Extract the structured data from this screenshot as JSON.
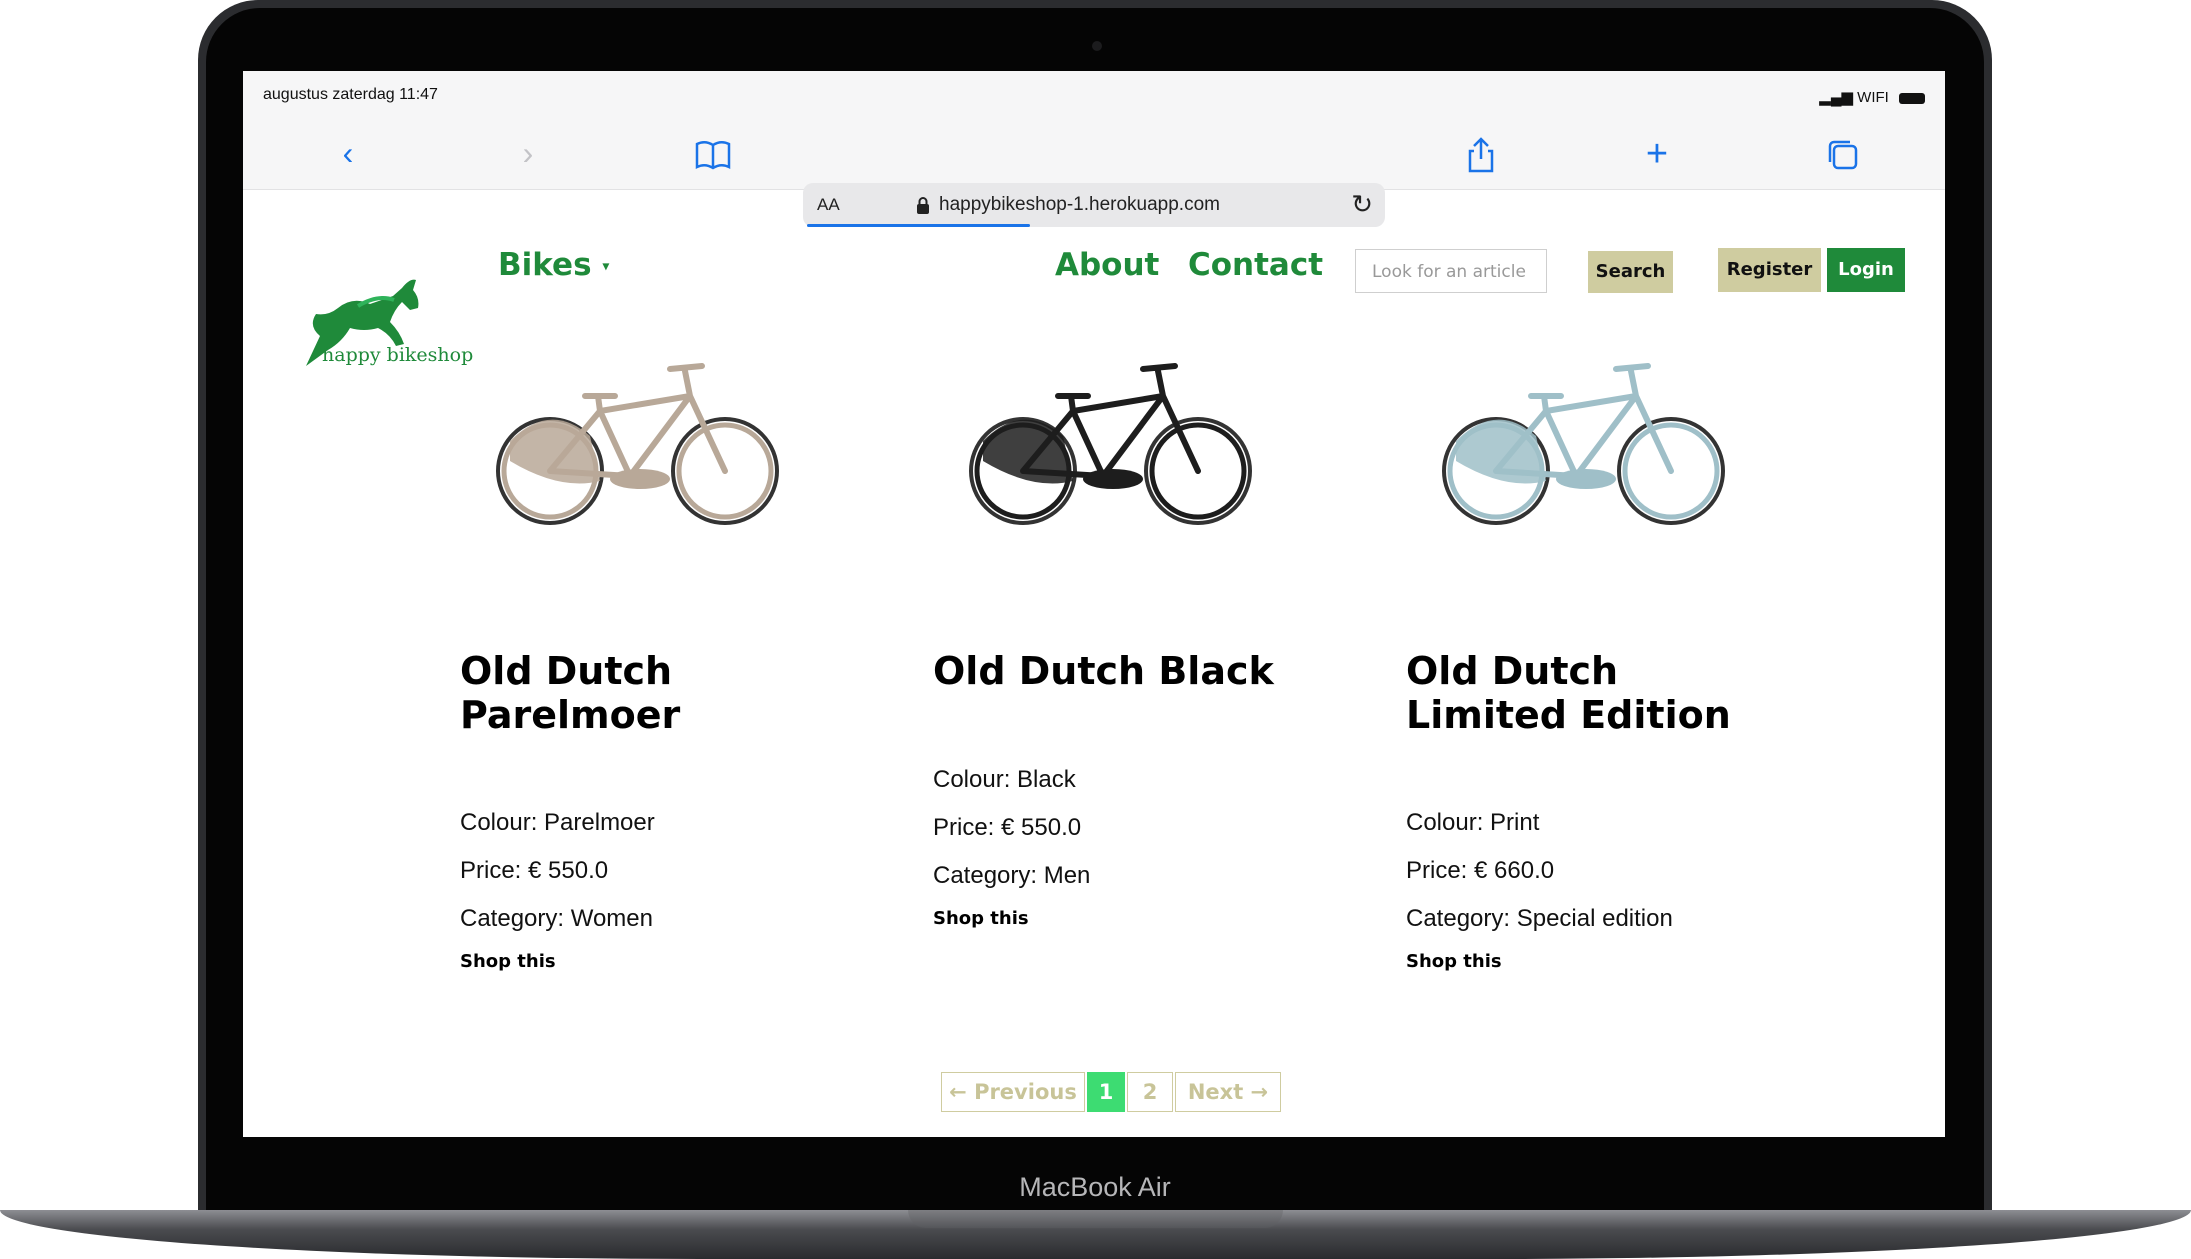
{
  "status": {
    "time": "augustus zaterdag 11:47",
    "network": "WIFI"
  },
  "browser": {
    "font_size_label": "AA",
    "url": "happybikeshop-1.herokuapp.com"
  },
  "site": {
    "logo_text": "happy bikeshop",
    "nav": {
      "bikes": "Bikes",
      "about": "About",
      "contact": "Contact"
    },
    "search": {
      "placeholder": "Look for an article",
      "button": "Search"
    },
    "auth": {
      "register": "Register",
      "login": "Login"
    },
    "brand_color": "#1f8a3a",
    "accent_color": "#cfcca0"
  },
  "products": [
    {
      "name": "Old Dutch Parelmoer",
      "colour": "Colour: Parelmoer",
      "price": "Price: € 550.0",
      "category": "Category: Women",
      "shop": "Shop this",
      "frame_color": "#b8a898"
    },
    {
      "name": "Old Dutch Black",
      "colour": "Colour: Black",
      "price": "Price: € 550.0",
      "category": "Category: Men",
      "shop": "Shop this",
      "frame_color": "#1d1d1d"
    },
    {
      "name": "Old Dutch Limited Edition",
      "colour": "Colour: Print",
      "price": "Price: € 660.0",
      "category": "Category: Special edition",
      "shop": "Shop this",
      "frame_color": "#9fbfc8"
    }
  ],
  "pagination": {
    "previous": "← Previous",
    "pages": [
      "1",
      "2"
    ],
    "current": "1",
    "next": "Next →"
  },
  "device_label": "MacBook Air"
}
